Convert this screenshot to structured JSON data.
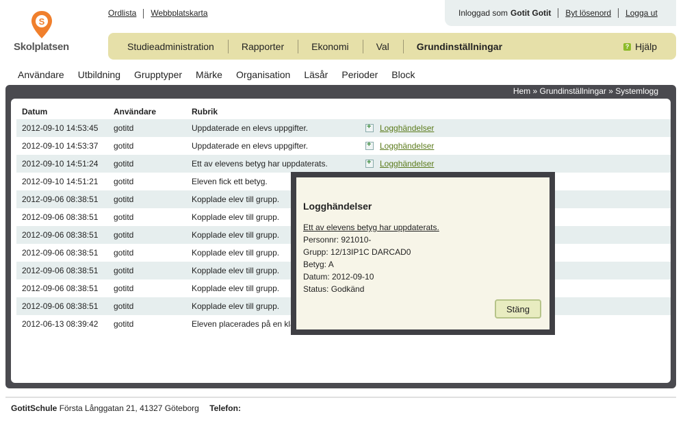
{
  "logo": {
    "text": "Skolplatsen"
  },
  "top_links": {
    "glossary": "Ordlista",
    "sitemap": "Webbplatskarta"
  },
  "user_box": {
    "logged_in_prefix": "Inloggad som",
    "user_name": "Gotit Gotit",
    "change_password": "Byt lösenord",
    "logout": "Logga ut"
  },
  "main_nav": {
    "items": [
      "Studieadministration",
      "Rapporter",
      "Ekonomi",
      "Val",
      "Grundinställningar"
    ],
    "active": "Grundinställningar",
    "help": "Hjälp"
  },
  "sub_nav": [
    "Användare",
    "Utbildning",
    "Grupptyper",
    "Märke",
    "Organisation",
    "Läsår",
    "Perioder",
    "Block"
  ],
  "breadcrumb": {
    "home": "Hem",
    "section": "Grundinställningar",
    "page": "Systemlogg",
    "separator": "»"
  },
  "table": {
    "headers": [
      "Datum",
      "Användare",
      "Rubrik"
    ],
    "rows": [
      {
        "date": "2012-09-10 14:53:45",
        "user": "gotitd",
        "subject": "Uppdaterade en elevs uppgifter.",
        "link": "Logghändelser"
      },
      {
        "date": "2012-09-10 14:53:37",
        "user": "gotitd",
        "subject": "Uppdaterade en elevs uppgifter.",
        "link": "Logghändelser"
      },
      {
        "date": "2012-09-10 14:51:24",
        "user": "gotitd",
        "subject": "Ett av elevens betyg har uppdaterats.",
        "link": "Logghändelser"
      },
      {
        "date": "2012-09-10 14:51:21",
        "user": "gotitd",
        "subject": "Eleven fick ett betyg.",
        "link": ""
      },
      {
        "date": "2012-09-06 08:38:51",
        "user": "gotitd",
        "subject": "Kopplade elev till grupp.",
        "link": ""
      },
      {
        "date": "2012-09-06 08:38:51",
        "user": "gotitd",
        "subject": "Kopplade elev till grupp.",
        "link": ""
      },
      {
        "date": "2012-09-06 08:38:51",
        "user": "gotitd",
        "subject": "Kopplade elev till grupp.",
        "link": ""
      },
      {
        "date": "2012-09-06 08:38:51",
        "user": "gotitd",
        "subject": "Kopplade elev till grupp.",
        "link": ""
      },
      {
        "date": "2012-09-06 08:38:51",
        "user": "gotitd",
        "subject": "Kopplade elev till grupp.",
        "link": ""
      },
      {
        "date": "2012-09-06 08:38:51",
        "user": "gotitd",
        "subject": "Kopplade elev till grupp.",
        "link": ""
      },
      {
        "date": "2012-09-06 08:38:51",
        "user": "gotitd",
        "subject": "Kopplade elev till grupp.",
        "link": ""
      },
      {
        "date": "2012-06-13 08:39:42",
        "user": "gotitd",
        "subject": "Eleven placerades på en kla",
        "link": ""
      }
    ]
  },
  "modal": {
    "title": "Logghändelser",
    "subject": "Ett av elevens betyg har uppdaterats.",
    "lines": [
      "Personnr: 921010-",
      "Grupp: 12/13IP1C DARCAD0",
      "Betyg: A",
      "Datum: 2012-09-10",
      "Status: Godkänd"
    ],
    "close": "Stäng"
  },
  "footer": {
    "school": "GotitSchule",
    "address": "Första Långgatan 21, 41327 Göteborg",
    "phone_label": "Telefon:"
  },
  "colors": {
    "nav_bg": "#e6e0a9",
    "row_alt": "#e6eeee",
    "frame": "#4a4a4f",
    "logo_orange": "#f07f2c",
    "link_green": "#5a7a1a"
  }
}
